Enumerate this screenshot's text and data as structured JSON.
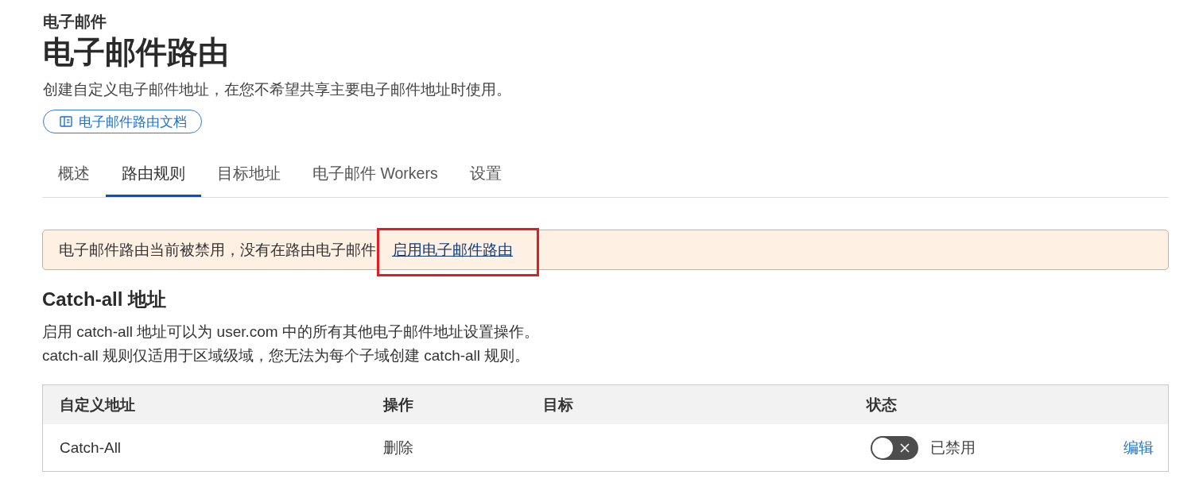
{
  "header": {
    "breadcrumb": "电子邮件",
    "title": "电子邮件路由",
    "description": "创建自定义电子邮件地址，在您不希望共享主要电子邮件地址时使用。",
    "docs_button": {
      "label": "电子邮件路由文档"
    }
  },
  "tabs": [
    {
      "label": "概述",
      "selected": false
    },
    {
      "label": "路由规则",
      "selected": true
    },
    {
      "label": "目标地址",
      "selected": false
    },
    {
      "label": "电子邮件 Workers",
      "selected": false
    },
    {
      "label": "设置",
      "selected": false
    }
  ],
  "alert": {
    "message": "电子邮件路由当前被禁用，没有在路由电子邮件",
    "link": {
      "label": "启用电子邮件路由",
      "highlighted": true
    }
  },
  "catch_all": {
    "title": "Catch-all 地址",
    "description_lines": [
      "启用 catch-all 地址可以为 user.com 中的所有其他电子邮件地址设置操作。",
      "catch-all 规则仅适用于区域级域，您无法为每个子域创建 catch-all 规则。"
    ],
    "table": {
      "columns": [
        "自定义地址",
        "操作",
        "目标",
        "状态"
      ],
      "rows": [
        {
          "address": "Catch-All",
          "action": "删除",
          "status": {
            "on": false,
            "label": "已禁用"
          },
          "edit": "编辑"
        }
      ]
    }
  }
}
